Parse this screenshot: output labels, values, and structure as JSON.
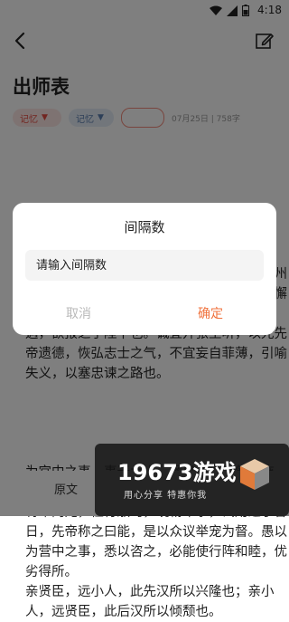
{
  "status_bar": {
    "time": "4:18"
  },
  "article": {
    "title": "出师表",
    "chip_memory_1": "记忆",
    "chip_memory_2": "记忆",
    "meta": "07月25日 | 758字",
    "paragraph_top": "先帝创业未半而中道崩殂，今天下三分，益州疲弊，此诚危急存亡之秋也。然侍卫之臣不懈于内，忠志之士忘身于外者，盖追先帝之殊遇，欲报之于陛下也。诚宜开张圣听，以光先帝遗德，恢弘志士之气，不宜妄自菲薄，引喻失义，以塞忠谏之路也。",
    "paragraph_bottom_1": "为宫中之事，事无大小，悉以咨之，然后施行，必得裨补阙漏，有所广益。",
    "paragraph_bottom_2": "将军向宠，性行淑均，晓畅军事，试用之于昔日，先帝称之曰能，是以众议举宠为督。愚以为营中之事，悉以咨之，必能使行阵和睦，优劣得所。",
    "paragraph_bottom_3": "亲贤臣，远小人，此先汉所以兴隆也；亲小人，远贤臣，此后汉所以倾颓也。"
  },
  "bottom_bar": {
    "original_label": "原文"
  },
  "dialog": {
    "title": "间隔数",
    "input_placeholder": "请输入间隔数",
    "cancel_label": "取消",
    "confirm_label": "确定"
  },
  "watermark": {
    "title": "19673游戏",
    "subtitle": "用心分享  特惠你我"
  },
  "colors": {
    "accent": "#f0723d",
    "chip_red": "#e54d42",
    "chip_blue": "#5a7fb0"
  }
}
